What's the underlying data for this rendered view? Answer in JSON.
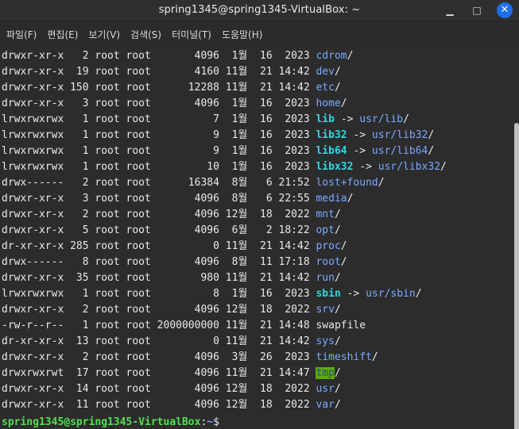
{
  "window": {
    "title": "spring1345@spring1345-VirtualBox: ~",
    "controls": {
      "minimize": "▁",
      "maximize": "□",
      "close": "✕"
    }
  },
  "menu": {
    "items": [
      "파일(F)",
      "편집(E)",
      "보기(V)",
      "검색(S)",
      "터미널(T)",
      "도움말(H)"
    ]
  },
  "terminal": {
    "lines": [
      {
        "meta": "drwxr-xr-x   2 root root       4096  1월  16  2023 ",
        "name": "cdrom",
        "suffix": "/",
        "type": "blue"
      },
      {
        "meta": "drwxr-xr-x  19 root root       4160 11월  21 14:42 ",
        "name": "dev",
        "suffix": "/",
        "type": "blue"
      },
      {
        "meta": "drwxr-xr-x 150 root root      12288 11월  21 14:42 ",
        "name": "etc",
        "suffix": "/",
        "type": "blue"
      },
      {
        "meta": "drwxr-xr-x   3 root root       4096  1월  16  2023 ",
        "name": "home",
        "suffix": "/",
        "type": "blue"
      },
      {
        "meta": "lrwxrwxrwx   1 root root          7  1월  16  2023 ",
        "name": "lib",
        "arrow": " -> ",
        "target": "usr/lib",
        "suffix": "/",
        "type": "link"
      },
      {
        "meta": "lrwxrwxrwx   1 root root          9  1월  16  2023 ",
        "name": "lib32",
        "arrow": " -> ",
        "target": "usr/lib32",
        "suffix": "/",
        "type": "link"
      },
      {
        "meta": "lrwxrwxrwx   1 root root          9  1월  16  2023 ",
        "name": "lib64",
        "arrow": " -> ",
        "target": "usr/lib64",
        "suffix": "/",
        "type": "link"
      },
      {
        "meta": "lrwxrwxrwx   1 root root         10  1월  16  2023 ",
        "name": "libx32",
        "arrow": " -> ",
        "target": "usr/libx32",
        "suffix": "/",
        "type": "link"
      },
      {
        "meta": "drwx------   2 root root      16384  8월   6 21:52 ",
        "name": "lost+found",
        "suffix": "/",
        "type": "blue"
      },
      {
        "meta": "drwxr-xr-x   3 root root       4096  8월   6 22:55 ",
        "name": "media",
        "suffix": "/",
        "type": "blue"
      },
      {
        "meta": "drwxr-xr-x   2 root root       4096 12월  18  2022 ",
        "name": "mnt",
        "suffix": "/",
        "type": "blue"
      },
      {
        "meta": "drwxr-xr-x   5 root root       4096  6월   2 18:22 ",
        "name": "opt",
        "suffix": "/",
        "type": "blue"
      },
      {
        "meta": "dr-xr-xr-x 285 root root          0 11월  21 14:42 ",
        "name": "proc",
        "suffix": "/",
        "type": "blue"
      },
      {
        "meta": "drwx------   8 root root       4096  8월  11 17:18 ",
        "name": "root",
        "suffix": "/",
        "type": "blue"
      },
      {
        "meta": "drwxr-xr-x  35 root root        980 11월  21 14:42 ",
        "name": "run",
        "suffix": "/",
        "type": "blue"
      },
      {
        "meta": "lrwxrwxrwx   1 root root          8  1월  16  2023 ",
        "name": "sbin",
        "arrow": " -> ",
        "target": "usr/sbin",
        "suffix": "/",
        "type": "link"
      },
      {
        "meta": "drwxr-xr-x   2 root root       4096 12월  18  2022 ",
        "name": "srv",
        "suffix": "/",
        "type": "blue"
      },
      {
        "meta": "-rw-r--r--   1 root root 2000000000 11월  21 14:48 ",
        "name": "swapfile",
        "suffix": "",
        "type": "plain"
      },
      {
        "meta": "dr-xr-xr-x  13 root root          0 11월  21 14:42 ",
        "name": "sys",
        "suffix": "/",
        "type": "blue"
      },
      {
        "meta": "drwxr-xr-x   2 root root       4096  3월  26  2023 ",
        "name": "timeshift",
        "suffix": "/",
        "type": "blue"
      },
      {
        "meta": "drwxrwxrwt  17 root root       4096 11월  21 14:47 ",
        "name": "tmp",
        "suffix": "/",
        "type": "highlight"
      },
      {
        "meta": "drwxr-xr-x  14 root root       4096 12월  18  2022 ",
        "name": "usr",
        "suffix": "/",
        "type": "blue"
      },
      {
        "meta": "drwxr-xr-x  11 root root       4096 12월  18  2022 ",
        "name": "var",
        "suffix": "/",
        "type": "blue"
      }
    ],
    "prompt": {
      "user_host": "spring1345@spring1345-VirtualBox",
      "separator": ":",
      "path": "~",
      "symbol": "$"
    }
  },
  "colors": {
    "blue": "#7aa9ff",
    "cyan": "#31d5e3",
    "green": "#4fe04f",
    "highlight_bg": "#5ea800"
  }
}
